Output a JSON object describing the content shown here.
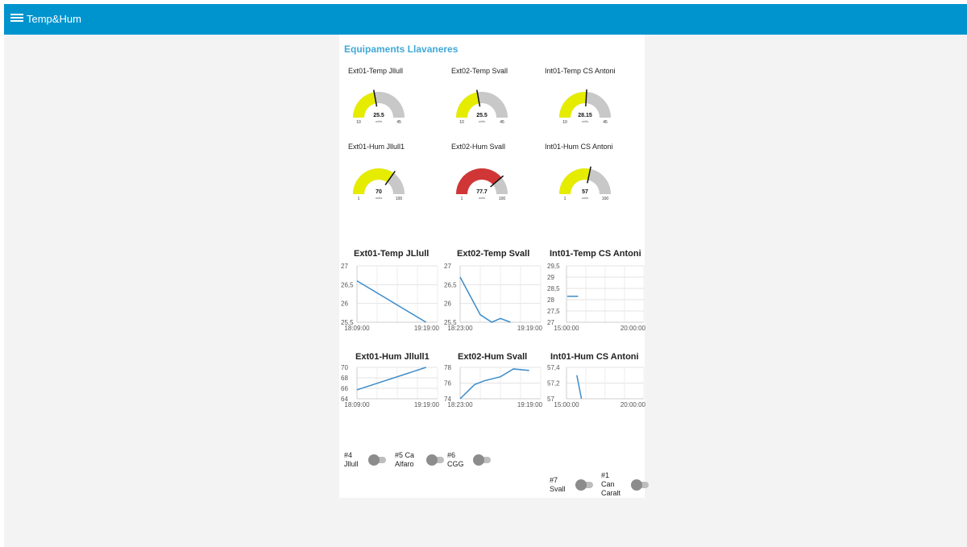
{
  "header": {
    "title": "Temp&Hum"
  },
  "group": {
    "title": "Equipaments Llavaneres"
  },
  "colors": {
    "toolbar": "#0094ce",
    "gauge_normal": "#e6ec00",
    "gauge_alarm": "#d03636",
    "gauge_rest": "#c8c8c8",
    "line": "#3c8cca"
  },
  "gauges": [
    {
      "label": "Ext01-Temp Jllull",
      "value": 25.5,
      "value_text": "25.5",
      "min": 10,
      "max": 45,
      "min_text": "10",
      "max_text": "45",
      "units": "units",
      "alarm": false
    },
    {
      "label": "Ext02-Temp Svall",
      "value": 25.5,
      "value_text": "25.5",
      "min": 10,
      "max": 45,
      "min_text": "10",
      "max_text": "45",
      "units": "units",
      "alarm": false
    },
    {
      "label": "Int01-Temp CS Antoni",
      "value": 28.15,
      "value_text": "28.15",
      "min": 10,
      "max": 45,
      "min_text": "10",
      "max_text": "45",
      "units": "units",
      "alarm": false
    },
    {
      "label": "Ext01-Hum Jllull1",
      "value": 70,
      "value_text": "70",
      "min": 1,
      "max": 100,
      "min_text": "1",
      "max_text": "100",
      "units": "units",
      "alarm": false
    },
    {
      "label": "Ext02-Hum Svall",
      "value": 77.7,
      "value_text": "77.7",
      "min": 1,
      "max": 100,
      "min_text": "1",
      "max_text": "100",
      "units": "units",
      "alarm": true
    },
    {
      "label": "Int01-Hum CS Antoni",
      "value": 57,
      "value_text": "57",
      "min": 1,
      "max": 100,
      "min_text": "1",
      "max_text": "100",
      "units": "units",
      "alarm": false
    }
  ],
  "chart_data": [
    {
      "type": "line",
      "title": "Ext01-Temp JLlull",
      "yticks": [
        "27",
        "26,5",
        "26",
        "25,5"
      ],
      "ytick_values": [
        27,
        26.5,
        26,
        25.5
      ],
      "ylim": [
        25.5,
        27
      ],
      "xticks": [
        "18:09:00",
        "19:19:00"
      ],
      "xtick_values": [
        0,
        70
      ],
      "xlim": [
        0,
        70
      ],
      "x_unit": "minutes after 18:09:00",
      "series": [
        {
          "x": [
            0,
            60
          ],
          "y": [
            26.6,
            25.5
          ]
        }
      ]
    },
    {
      "type": "line",
      "title": "Ext02-Temp Svall",
      "yticks": [
        "27",
        "26,5",
        "26",
        "25,5"
      ],
      "ytick_values": [
        27,
        26.5,
        26,
        25.5
      ],
      "ylim": [
        25.5,
        27
      ],
      "xticks": [
        "18:23:00",
        "19:19:00"
      ],
      "xtick_values": [
        0,
        56
      ],
      "xlim": [
        0,
        56
      ],
      "series": [
        {
          "x": [
            0,
            14,
            22,
            28,
            35
          ],
          "y": [
            26.7,
            25.7,
            25.5,
            25.6,
            25.5
          ]
        }
      ]
    },
    {
      "type": "line",
      "title": "Int01-Temp CS Antoni",
      "yticks": [
        "29,5",
        "29",
        "28,5",
        "28",
        "27,5",
        "27"
      ],
      "ytick_values": [
        29.5,
        29,
        28.5,
        28,
        27.5,
        27
      ],
      "ylim": [
        27,
        29.5
      ],
      "xticks": [
        "15:00:00",
        "20:00:00"
      ],
      "xtick_values": [
        0,
        300
      ],
      "xlim": [
        0,
        300
      ],
      "series": [
        {
          "x": [
            3,
            45
          ],
          "y": [
            28.15,
            28.15
          ]
        }
      ]
    },
    {
      "type": "line",
      "title": "Ext01-Hum Jllull1",
      "yticks": [
        "70",
        "68",
        "66",
        "64"
      ],
      "ytick_values": [
        70,
        68,
        66,
        64
      ],
      "ylim": [
        64,
        70
      ],
      "xticks": [
        "18:09:00",
        "19:19:00"
      ],
      "xtick_values": [
        0,
        70
      ],
      "xlim": [
        0,
        70
      ],
      "series": [
        {
          "x": [
            0,
            60
          ],
          "y": [
            65.7,
            70
          ]
        }
      ]
    },
    {
      "type": "line",
      "title": "Ext02-Hum Svall",
      "yticks": [
        "78",
        "76",
        "74"
      ],
      "ytick_values": [
        78,
        76,
        74
      ],
      "ylim": [
        74,
        78
      ],
      "xticks": [
        "18:23:00",
        "19:19:00"
      ],
      "xtick_values": [
        0,
        56
      ],
      "xlim": [
        0,
        56
      ],
      "series": [
        {
          "x": [
            0,
            10,
            17,
            28,
            37,
            48
          ],
          "y": [
            74,
            75.8,
            76.3,
            76.8,
            77.8,
            77.6
          ]
        }
      ]
    },
    {
      "type": "line",
      "title": "Int01-Hum CS Antoni",
      "yticks": [
        "57,4",
        "57,2",
        "57"
      ],
      "ytick_values": [
        57.4,
        57.2,
        57
      ],
      "ylim": [
        57,
        57.4
      ],
      "xticks": [
        "15:00:00",
        "20:00:00"
      ],
      "xtick_values": [
        0,
        300
      ],
      "xlim": [
        0,
        300
      ],
      "series": [
        {
          "x": [
            40,
            58
          ],
          "y": [
            57.3,
            57
          ]
        }
      ]
    }
  ],
  "switches": [
    {
      "label_lines": [
        "#4",
        "Jllull"
      ],
      "on": false
    },
    {
      "label_lines": [
        "#5 Ca",
        "Alfaro"
      ],
      "on": false
    },
    {
      "label_lines": [
        "#6",
        "CGG"
      ],
      "on": false
    },
    {
      "label_lines": [
        "#7",
        "Svall"
      ],
      "on": false
    },
    {
      "label_lines": [
        "#1",
        "Can",
        "Caralt"
      ],
      "on": false
    }
  ]
}
